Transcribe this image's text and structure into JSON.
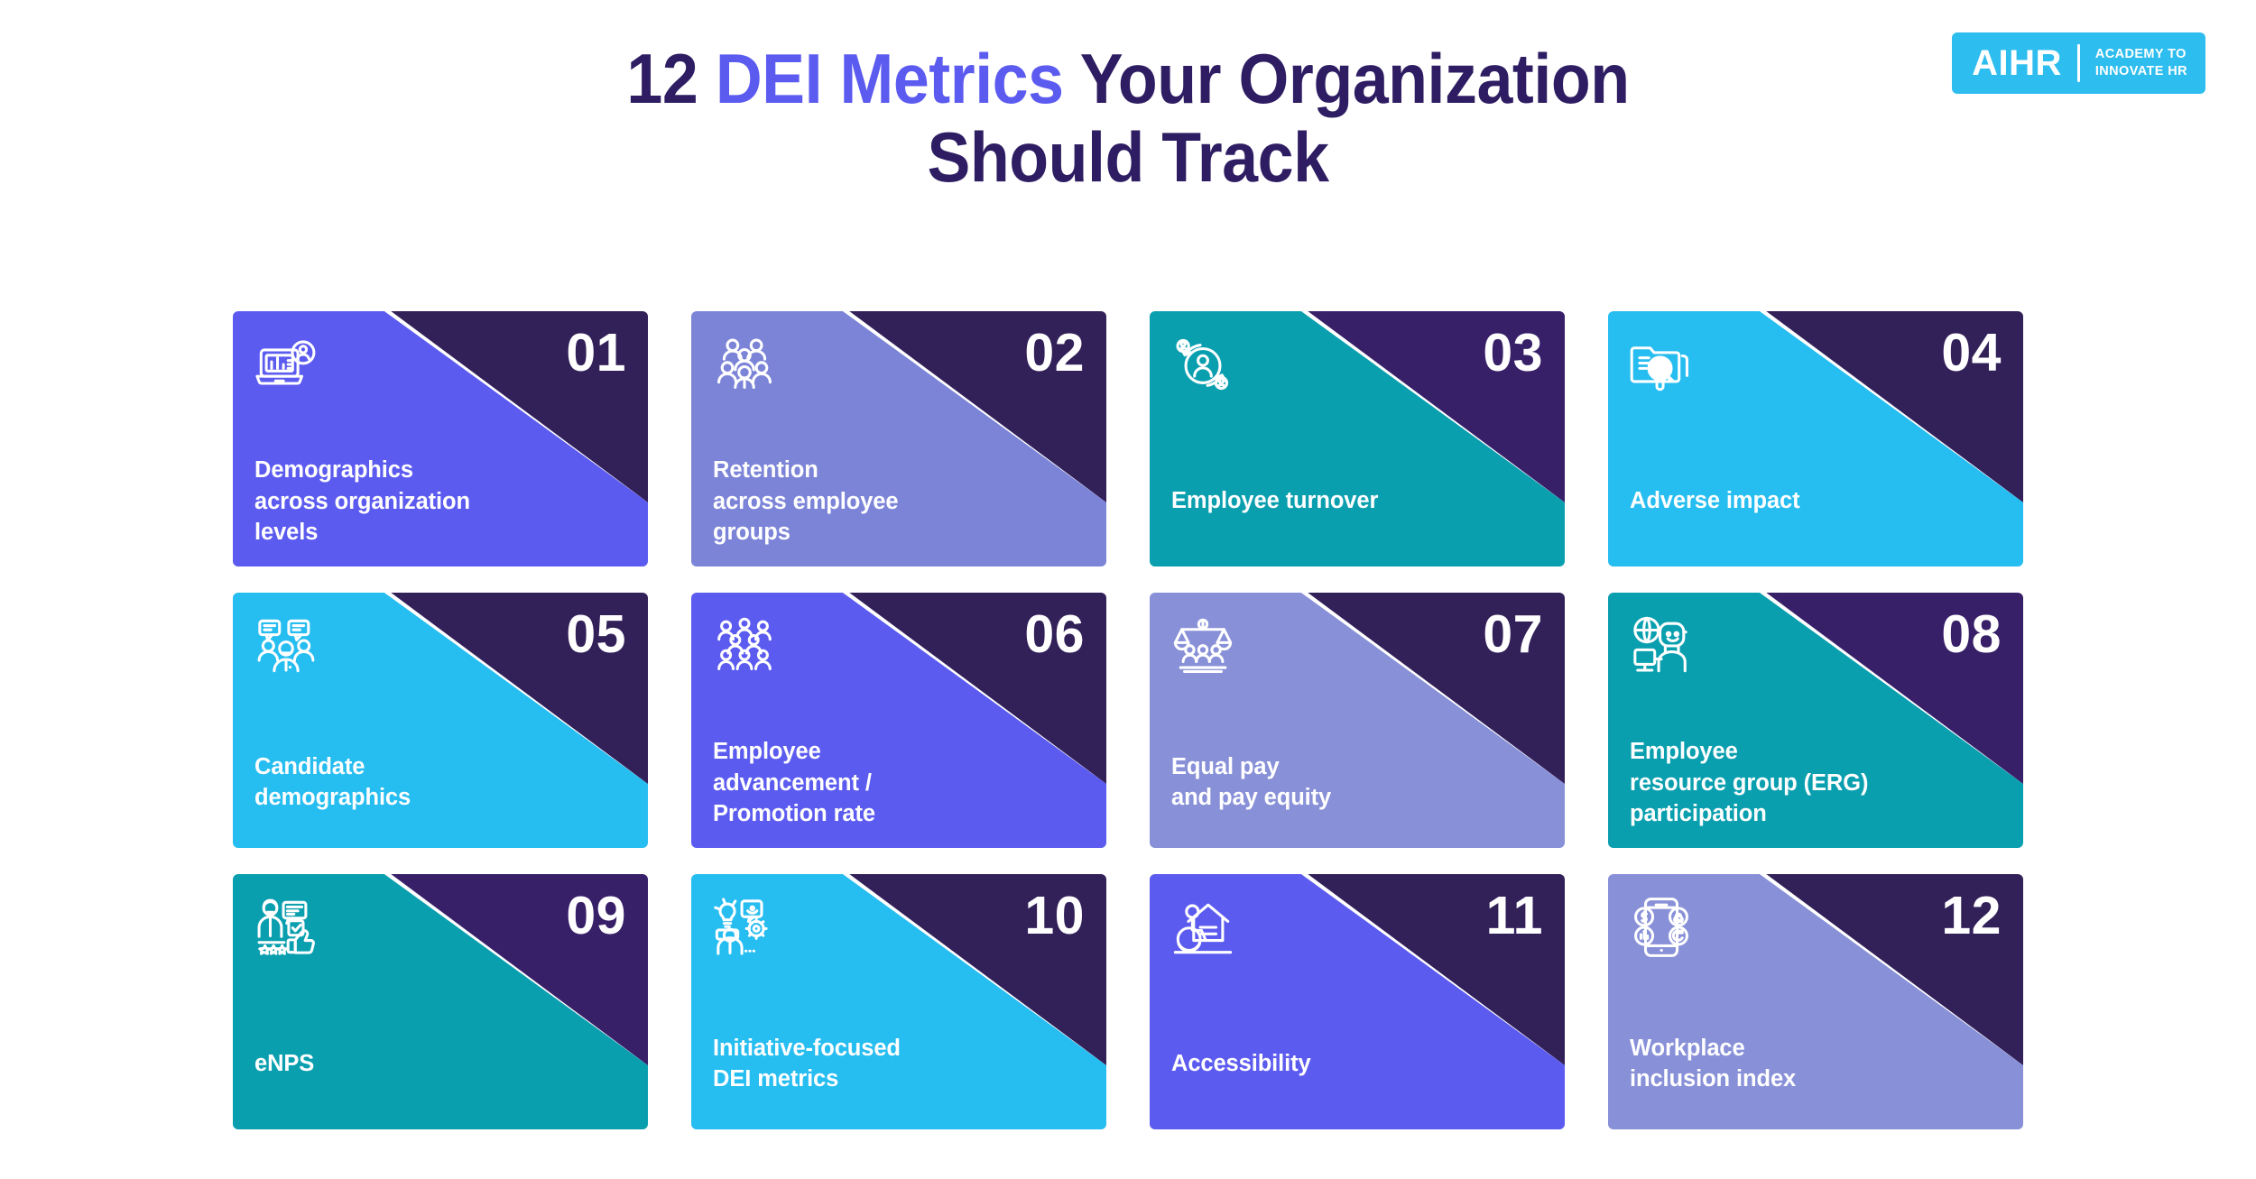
{
  "logo": {
    "mark": "AIHR",
    "sub_line1": "ACADEMY TO",
    "sub_line2": "INNOVATE HR",
    "bg_color": "#2DBDEE"
  },
  "title": {
    "part1": "12 ",
    "accent": "DEI Metrics",
    "part2": " Your Organization",
    "line2": "Should Track",
    "color": "#2E1D62",
    "accent_color": "#5C5BF0"
  },
  "cards": [
    {
      "number": "01",
      "label": "Demographics\nacross organization\nlevels",
      "icon": "laptop-chart-person-icon",
      "bg": "#5C5BF0",
      "wedge": "#322059",
      "lines": 3
    },
    {
      "number": "02",
      "label": "Retention\nacross employee\ngroups",
      "icon": "group-of-people-icon",
      "bg": "#7C84D8",
      "wedge": "#322059",
      "lines": 3
    },
    {
      "number": "03",
      "label": "Employee turnover",
      "icon": "turnover-cycle-people-icon",
      "bg": "#0A9FAF",
      "wedge": "#382069",
      "lines": 1
    },
    {
      "number": "04",
      "label": "Adverse impact",
      "icon": "folder-magnifier-info-icon",
      "bg": "#26BDF0",
      "wedge": "#322059",
      "lines": 1
    },
    {
      "number": "05",
      "label": "Candidate\ndemographics",
      "icon": "people-speech-bubbles-icon",
      "bg": "#26BDF0",
      "wedge": "#322059",
      "lines": 2
    },
    {
      "number": "06",
      "label": "Employee\nadvancement /\nPromotion rate",
      "icon": "crowd-promotion-icon",
      "bg": "#5C5BF0",
      "wedge": "#322059",
      "lines": 3
    },
    {
      "number": "07",
      "label": "Equal pay\nand pay equity",
      "icon": "scales-pay-equity-icon",
      "bg": "#8890D8",
      "wedge": "#322059",
      "lines": 2
    },
    {
      "number": "08",
      "label": "Employee\nresource group (ERG)\nparticipation",
      "icon": "globe-person-desk-icon",
      "bg": "#0A9FAF",
      "wedge": "#382069",
      "lines": 3
    },
    {
      "number": "09",
      "label": "eNPS",
      "icon": "survey-thumbs-up-stars-icon",
      "bg": "#0A9FAF",
      "wedge": "#382069",
      "lines": 1
    },
    {
      "number": "10",
      "label": "Initiative-focused\nDEI metrics",
      "icon": "lightbulb-gear-people-icon",
      "bg": "#26BDF0",
      "wedge": "#322059",
      "lines": 2
    },
    {
      "number": "11",
      "label": "Accessibility",
      "icon": "wheelchair-ramp-house-icon",
      "bg": "#5C5BF0",
      "wedge": "#322059",
      "lines": 1
    },
    {
      "number": "12",
      "label": "Workplace\ninclusion index",
      "icon": "mobile-inclusion-index-icon",
      "bg": "#8890D8",
      "wedge": "#322059",
      "lines": 2
    }
  ]
}
